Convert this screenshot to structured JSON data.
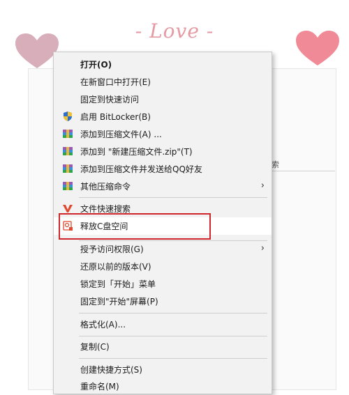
{
  "background": {
    "title": "- Love -",
    "fragment_text": "索"
  },
  "menu": {
    "items": [
      {
        "label": "打开(O)",
        "bold": true
      },
      {
        "label": "在新窗口中打开(E)"
      },
      {
        "label": "固定到快速访问"
      },
      {
        "label": "启用 BitLocker(B)",
        "icon": "shield-icon"
      },
      {
        "label": "添加到压缩文件(A) ...",
        "icon": "archive-icon"
      },
      {
        "label": "添加到 \"新建压缩文件.zip\"(T)",
        "icon": "archive-icon"
      },
      {
        "label": "添加到压缩文件并发送给QQ好友",
        "icon": "archive-icon"
      },
      {
        "label": "其他压缩命令",
        "icon": "archive-icon",
        "submenu": true
      },
      {
        "label": "文件快速搜索",
        "icon": "search-tool-icon"
      },
      {
        "label": "释放C盘空间",
        "icon": "cleanup-icon"
      },
      {
        "label": "授予访问权限(G)",
        "submenu": true
      },
      {
        "label": "还原以前的版本(V)"
      },
      {
        "label": "锁定到「开始」菜单"
      },
      {
        "label": "固定到\"开始\"屏幕(P)"
      },
      {
        "label": "格式化(A)..."
      },
      {
        "label": "复制(C)"
      },
      {
        "label": "创建快捷方式(S)"
      },
      {
        "label": "重命名(M)"
      }
    ],
    "submenu_arrow": "›"
  },
  "colors": {
    "highlight_box": "#d0262b",
    "heart": "#f08a97",
    "heart_left": "#c9a0b0"
  }
}
